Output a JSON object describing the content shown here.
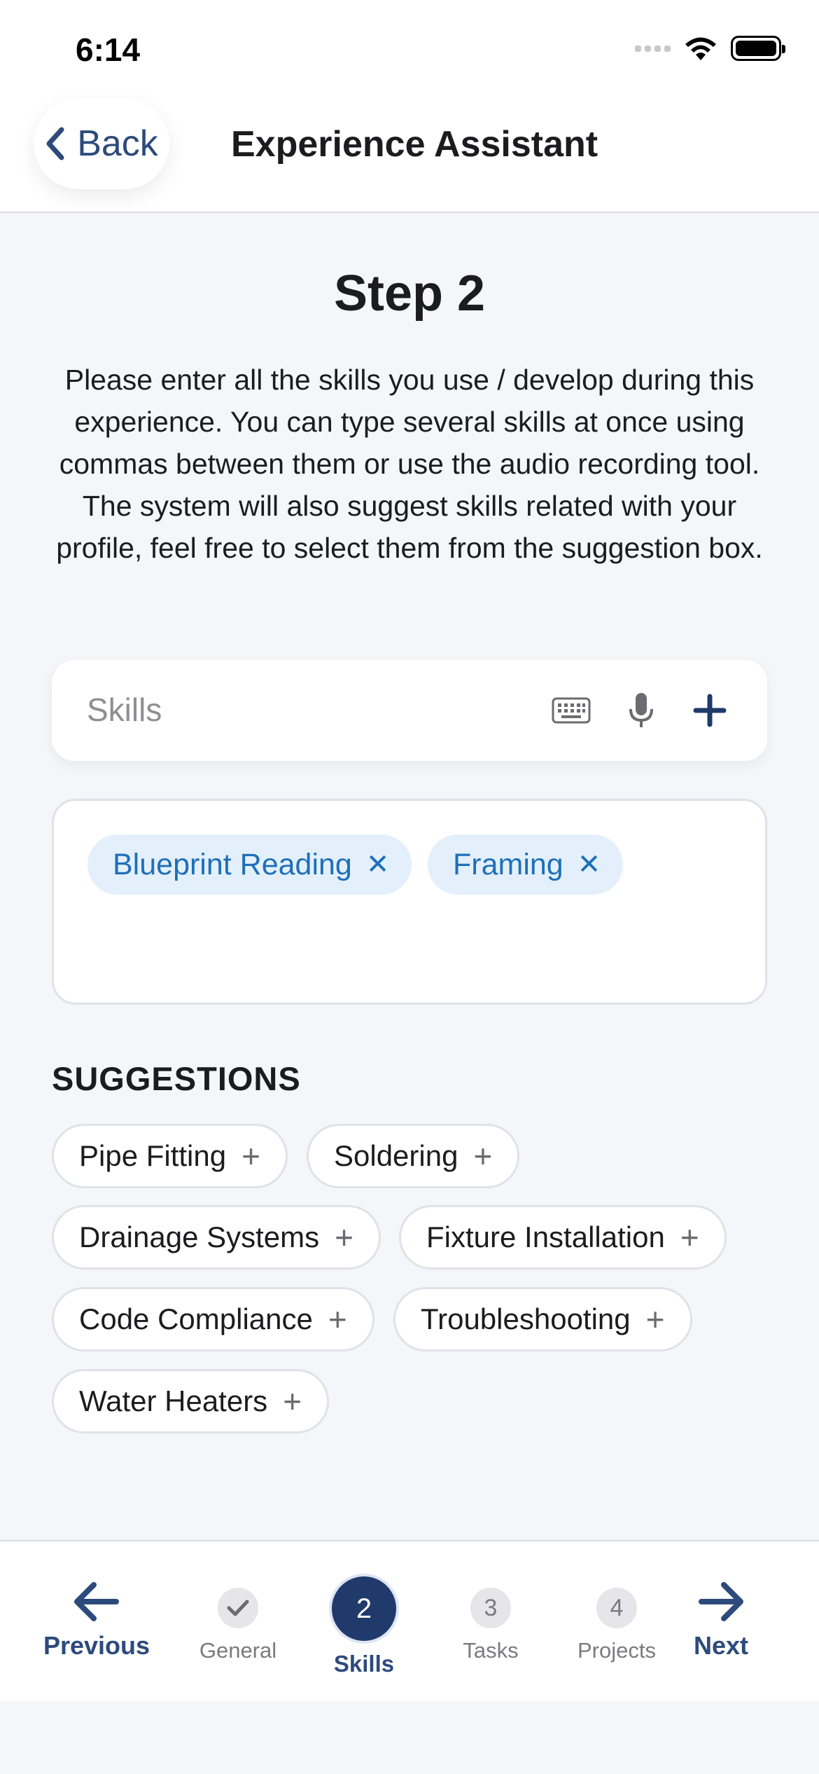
{
  "status_bar": {
    "time": "6:14"
  },
  "nav": {
    "back_label": "Back",
    "title": "Experience Assistant"
  },
  "step": {
    "title": "Step 2",
    "instructions": "Please enter all the skills you use / develop during this experience. You can type several skills at once using commas between them or use the audio recording tool. The system will also suggest skills related with your profile, feel free to select them from the suggestion box."
  },
  "skills_input": {
    "placeholder": "Skills",
    "value": ""
  },
  "selected_skills": [
    "Blueprint Reading",
    "Framing"
  ],
  "suggestions": {
    "heading": "SUGGESTIONS",
    "items": [
      "Pipe Fitting",
      "Soldering",
      "Drainage Systems",
      "Fixture Installation",
      "Code Compliance",
      "Troubleshooting",
      "Water Heaters"
    ]
  },
  "bottom_nav": {
    "previous_label": "Previous",
    "next_label": "Next",
    "steps": [
      {
        "label": "General",
        "number": "",
        "state": "done"
      },
      {
        "label": "Skills",
        "number": "2",
        "state": "active"
      },
      {
        "label": "Tasks",
        "number": "3",
        "state": "pending"
      },
      {
        "label": "Projects",
        "number": "4",
        "state": "pending"
      }
    ]
  },
  "icons": {
    "back": "chevron-left-icon",
    "keyboard": "keyboard-icon",
    "microphone": "microphone-icon",
    "add": "plus-icon",
    "remove": "close-icon",
    "previous": "arrow-left-icon",
    "next": "arrow-right-icon",
    "done": "checkmark-icon"
  },
  "colors": {
    "accent": "#2d4a7c",
    "active_step": "#1f3a6b",
    "chip_bg": "#e3f0fc",
    "chip_text": "#1f6fb8",
    "background": "#f4f6f9"
  }
}
